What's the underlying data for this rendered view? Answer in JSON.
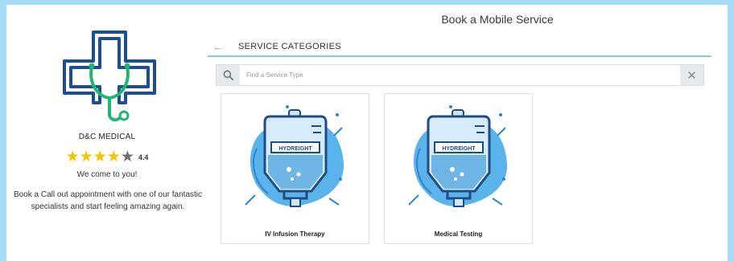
{
  "colors": {
    "background": "#a6dcf7",
    "accent_teal": "#7fd1d7",
    "logo_blue": "#1f4f8a",
    "logo_green": "#22b573",
    "star": "#f5c300"
  },
  "profile": {
    "logo_icon": "medical-cross-stethoscope-icon",
    "name": "D&C MEDICAL",
    "rating": {
      "value": 4.4,
      "max": 5,
      "label": "4.4"
    },
    "tagline": "We come to you!",
    "description": "Book a Call out appointment with one of our fantastic specialists and start feeling amazing again."
  },
  "page": {
    "title": "Book a Mobile Service"
  },
  "categories_header": {
    "back_icon": "arrow-left-icon",
    "title": "SERVICE CATEGORIES"
  },
  "search": {
    "icon": "search-icon",
    "placeholder": "Find a Service Type",
    "value": "",
    "clear_icon": "close-icon"
  },
  "cards": [
    {
      "label": "IV Infusion Therapy",
      "bag_text": "HYDREIGHT",
      "icon": "iv-bag-icon"
    },
    {
      "label": "Medical Testing",
      "bag_text": "HYDREIGHT",
      "icon": "iv-bag-icon"
    }
  ]
}
